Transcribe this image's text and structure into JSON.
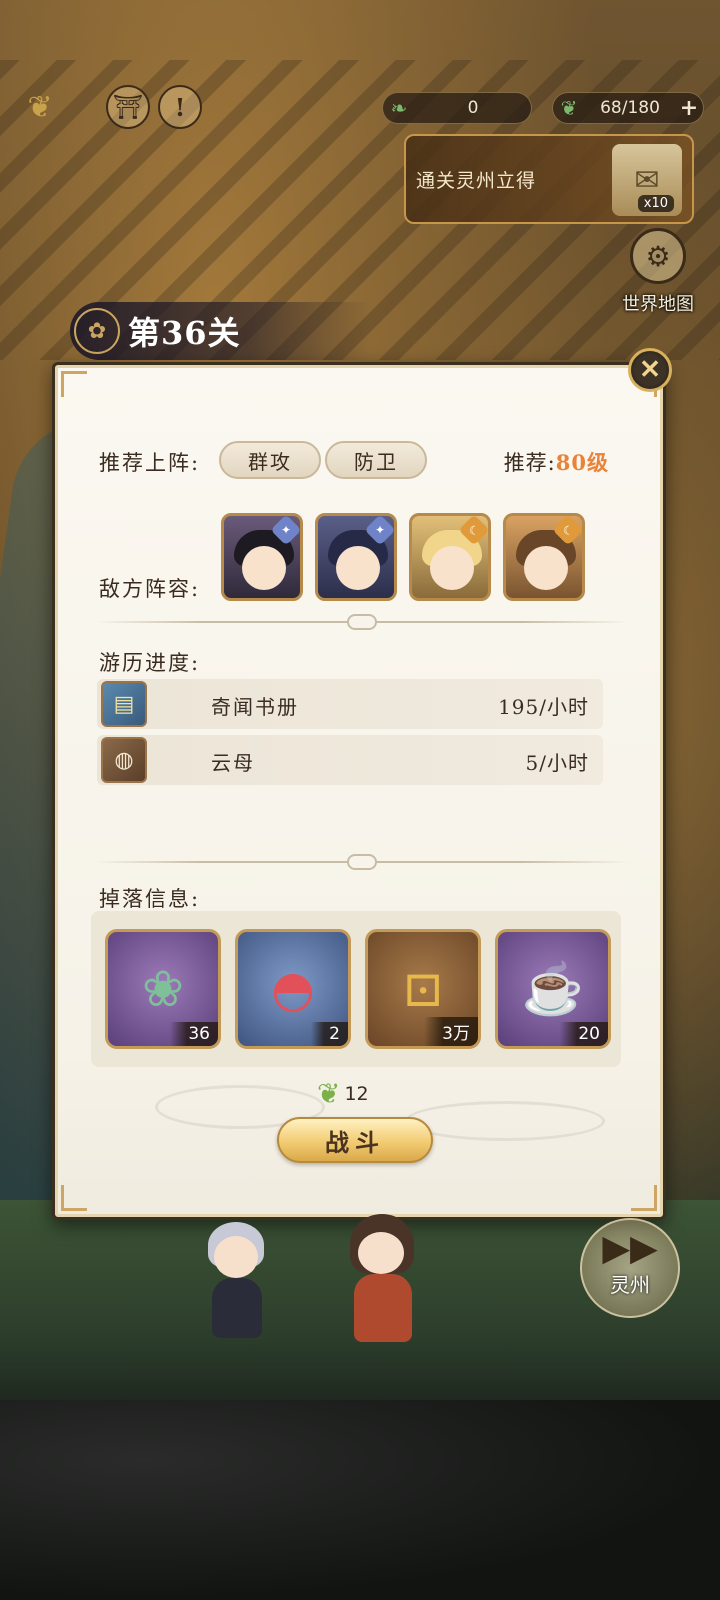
{
  "hud": {
    "jade_value": "0",
    "leaf_value": "68/180",
    "plus_label": "+",
    "quest_text": "通关灵州立得",
    "quest_reward_count": "x10",
    "world_map_label": "世界地图"
  },
  "stage": {
    "title": "第36关"
  },
  "panel": {
    "recommend_label": "推荐上阵:",
    "tags": [
      "群攻",
      "防卫"
    ],
    "recommend_level_prefix": "推荐:",
    "recommend_level": "80级",
    "enemy_label": "敌方阵容:",
    "progress_label": "游历进度:",
    "progress": [
      {
        "name": "奇闻书册",
        "rate": "195/小时"
      },
      {
        "name": "云母",
        "rate": "5/小时"
      }
    ],
    "drops_label": "掉落信息:",
    "drops": [
      {
        "qty": "36",
        "icon": "book-icon"
      },
      {
        "qty": "2",
        "icon": "bowl-icon"
      },
      {
        "qty": "3万",
        "icon": "coin-icon"
      },
      {
        "qty": "20",
        "icon": "tea-set-icon"
      }
    ],
    "cost": "12",
    "battle_label": "战斗"
  },
  "next_stage": {
    "label": "灵州"
  },
  "colors": {
    "accent_orange": "#e8833a",
    "gold": "#d8b15e",
    "panel_bg": "#fbf8f1"
  }
}
